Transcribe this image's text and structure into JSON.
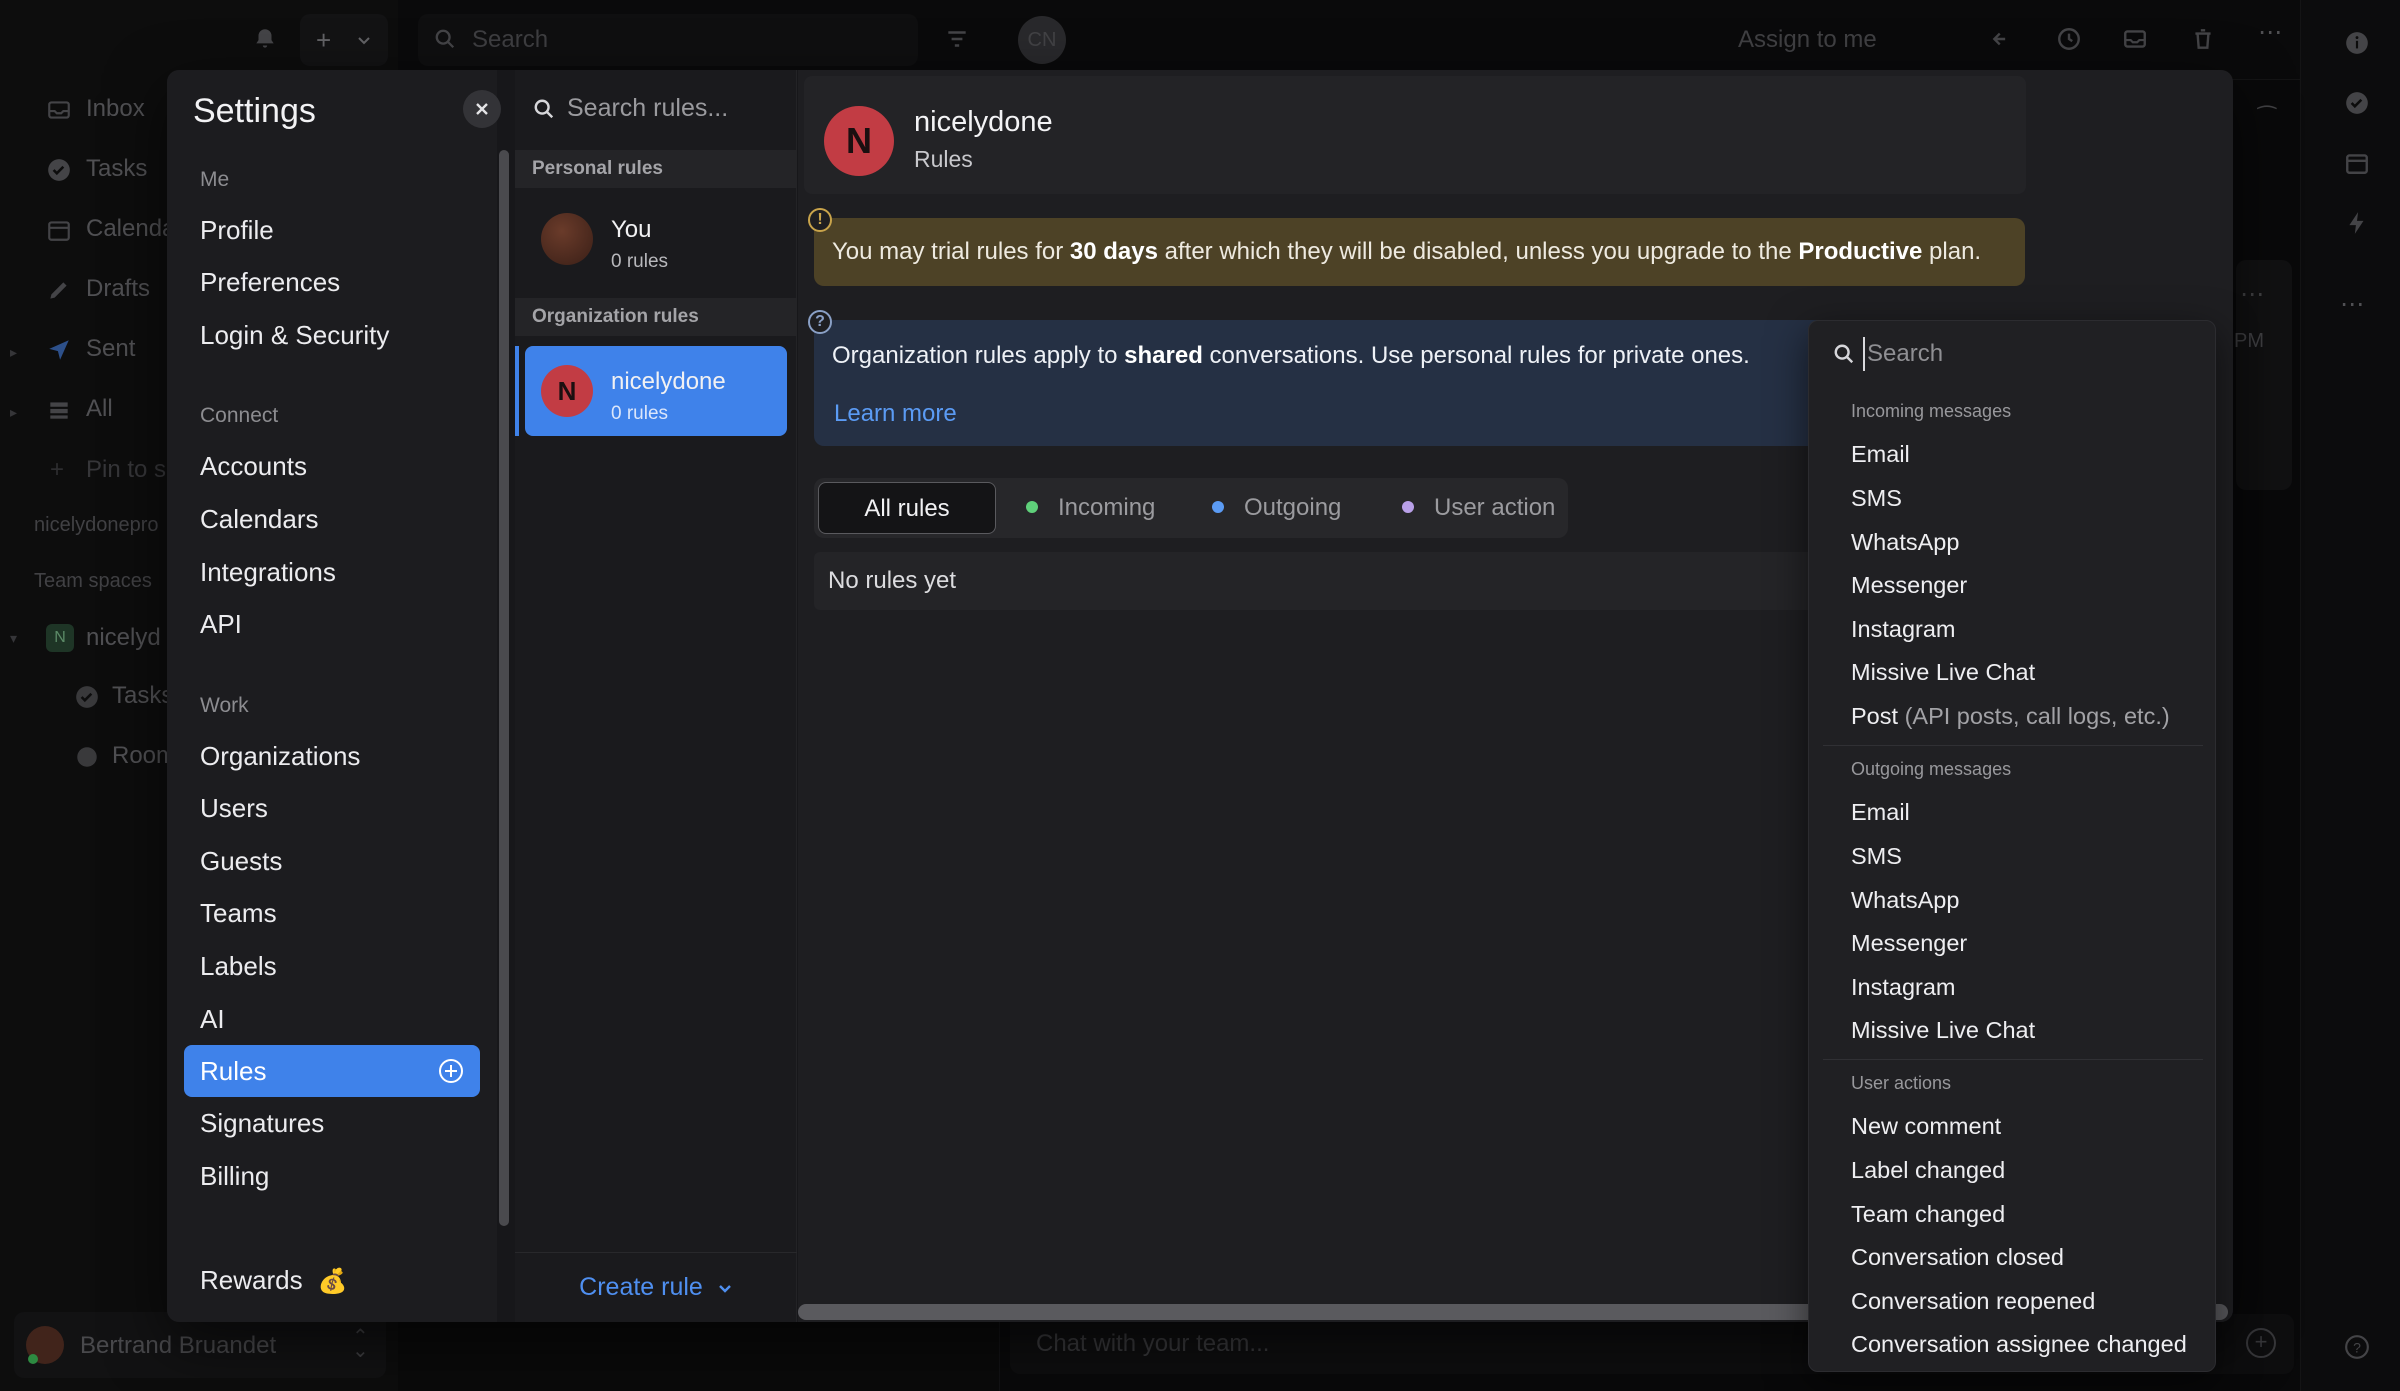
{
  "background": {
    "search_placeholder": "Search",
    "assign_label": "Assign to me",
    "avatar_initials": "CN",
    "sidebar_items": [
      {
        "label": "Inbox",
        "icon": "inbox-icon"
      },
      {
        "label": "Tasks",
        "icon": "check-circle-icon"
      },
      {
        "label": "Calenda",
        "icon": "calendar-icon"
      },
      {
        "label": "Drafts",
        "icon": "pencil-icon"
      },
      {
        "label": "Sent",
        "icon": "send-icon"
      },
      {
        "label": "All",
        "icon": "stack-icon"
      }
    ],
    "pin_label": "Pin to s",
    "org_label": "nicelydonepro",
    "team_spaces_label": "Team spaces",
    "team_item": "nicelyd",
    "team_initial": "N",
    "team_sub_items": [
      "Tasks",
      "Room"
    ],
    "user_name": "Bertrand Bruandet",
    "chat_placeholder": "Chat with your team...",
    "time_fragment": "PM"
  },
  "settings": {
    "title": "Settings",
    "sections": [
      {
        "heading": "Me",
        "items": [
          "Profile",
          "Preferences",
          "Login & Security"
        ]
      },
      {
        "heading": "Connect",
        "items": [
          "Accounts",
          "Calendars",
          "Integrations",
          "API"
        ]
      },
      {
        "heading": "Work",
        "items": [
          "Organizations",
          "Users",
          "Guests",
          "Teams",
          "Labels",
          "AI",
          "Rules",
          "Signatures",
          "Billing"
        ]
      }
    ],
    "active_item": "Rules",
    "rewards_label": "Rewards",
    "rewards_emoji": "💰"
  },
  "rules_list": {
    "search_placeholder": "Search rules...",
    "personal_heading": "Personal rules",
    "personal": {
      "name": "You",
      "count": "0 rules"
    },
    "org_heading": "Organization rules",
    "org": {
      "name": "nicelydone",
      "count": "0 rules",
      "initial": "N"
    },
    "create_label": "Create rule"
  },
  "main": {
    "org_initial": "N",
    "org_name": "nicelydone",
    "org_sub": "Rules",
    "warning": {
      "pre": "You may trial rules for ",
      "days": "30 days",
      "mid": " after which they will be disabled, unless you upgrade to the ",
      "plan": "Productive",
      "post": " plan.",
      "badge": "!"
    },
    "info": {
      "pre": "Organization rules apply to ",
      "bold": "shared",
      "post": " conversations. Use personal rules for private ones.",
      "learn_more": "Learn more",
      "badge": "?"
    },
    "tabs": [
      {
        "label": "All rules",
        "dot": ""
      },
      {
        "label": "Incoming",
        "dot": "#5fd07a"
      },
      {
        "label": "Outgoing",
        "dot": "#5b9bf4"
      },
      {
        "label": "User action",
        "dot": "#b9a0e8"
      }
    ],
    "empty_text": "No rules yet"
  },
  "dropdown": {
    "search_placeholder": "Search",
    "groups": [
      {
        "heading": "Incoming messages",
        "items": [
          "Email",
          "SMS",
          "WhatsApp",
          "Messenger",
          "Instagram",
          "Missive Live Chat",
          "Post"
        ],
        "post_note": "(API posts, call logs, etc.)"
      },
      {
        "heading": "Outgoing messages",
        "items": [
          "Email",
          "SMS",
          "WhatsApp",
          "Messenger",
          "Instagram",
          "Missive Live Chat"
        ]
      },
      {
        "heading": "User actions",
        "items": [
          "New comment",
          "Label changed",
          "Team changed",
          "Conversation closed",
          "Conversation reopened",
          "Conversation assignee changed"
        ]
      }
    ]
  },
  "colors": {
    "accent": "#3f82ea",
    "org_avatar": "#c23c44",
    "warning_bg": "#4d4226",
    "info_bg": "#253044"
  }
}
